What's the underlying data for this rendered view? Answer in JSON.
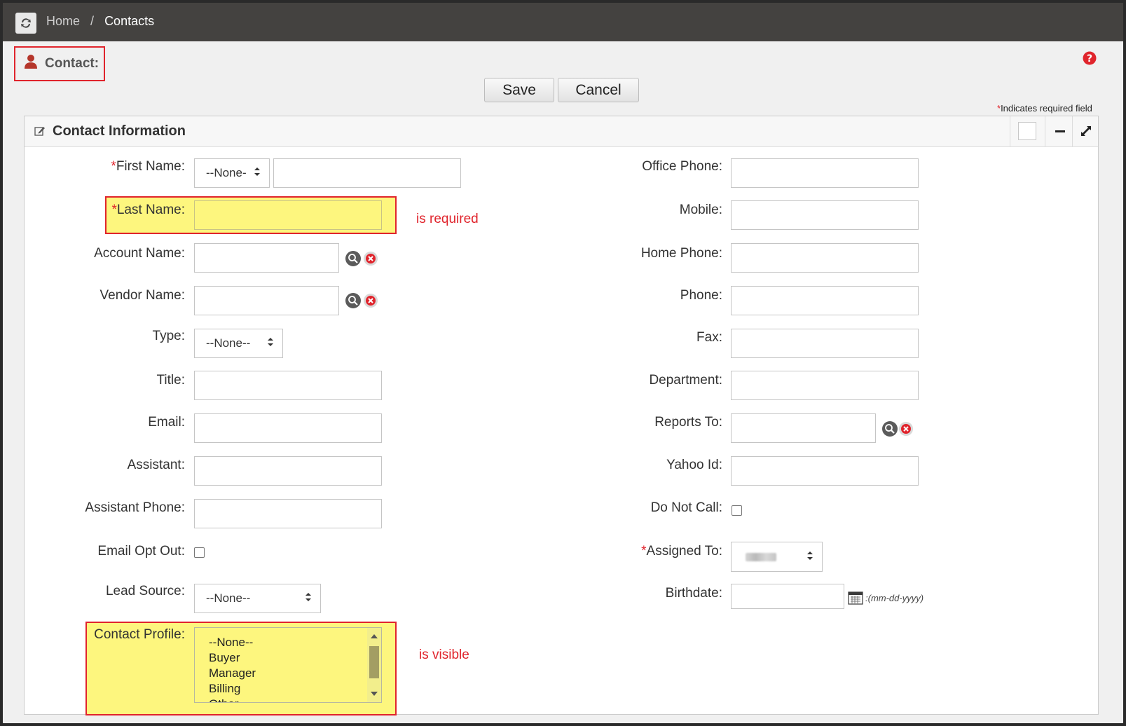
{
  "breadcrumb": {
    "home": "Home",
    "separator": "/",
    "current": "Contacts"
  },
  "header": {
    "title": "Contact:"
  },
  "toolbar": {
    "save_label": "Save",
    "cancel_label": "Cancel"
  },
  "required_note": {
    "star": "*",
    "text": "Indicates required field"
  },
  "panel": {
    "title": "Contact Information"
  },
  "left_fields": {
    "first_name": {
      "label": "First Name:",
      "required": "*",
      "salutation": "--None-"
    },
    "last_name": {
      "label": "Last Name:",
      "required": "*",
      "annotation": "is required"
    },
    "account_name": {
      "label": "Account Name:"
    },
    "vendor_name": {
      "label": "Vendor Name:"
    },
    "type": {
      "label": "Type:",
      "value": "--None--"
    },
    "title": {
      "label": "Title:"
    },
    "email": {
      "label": "Email:"
    },
    "assistant": {
      "label": "Assistant:"
    },
    "assistant_phone": {
      "label": "Assistant Phone:"
    },
    "email_opt_out": {
      "label": "Email Opt Out:"
    },
    "lead_source": {
      "label": "Lead Source:",
      "value": "--None--"
    },
    "contact_profile": {
      "label": "Contact Profile:",
      "annotation": "is visible",
      "options": [
        "--None--",
        "Buyer",
        "Manager",
        "Billing",
        "Other"
      ]
    }
  },
  "right_fields": {
    "office_phone": {
      "label": "Office Phone:"
    },
    "mobile": {
      "label": "Mobile:"
    },
    "home_phone": {
      "label": "Home Phone:"
    },
    "phone": {
      "label": "Phone:"
    },
    "fax": {
      "label": "Fax:"
    },
    "department": {
      "label": "Department:"
    },
    "reports_to": {
      "label": "Reports To:"
    },
    "yahoo_id": {
      "label": "Yahoo Id:"
    },
    "do_not_call": {
      "label": "Do Not Call:"
    },
    "assigned_to": {
      "label": "Assigned To:",
      "required": "*"
    },
    "birthdate": {
      "label": "Birthdate:",
      "hint": ":(mm-dd-yyyy)"
    }
  },
  "colors": {
    "accent_red": "#e0242c",
    "highlight_yellow": "#fdf67e",
    "topbar": "#444240"
  }
}
